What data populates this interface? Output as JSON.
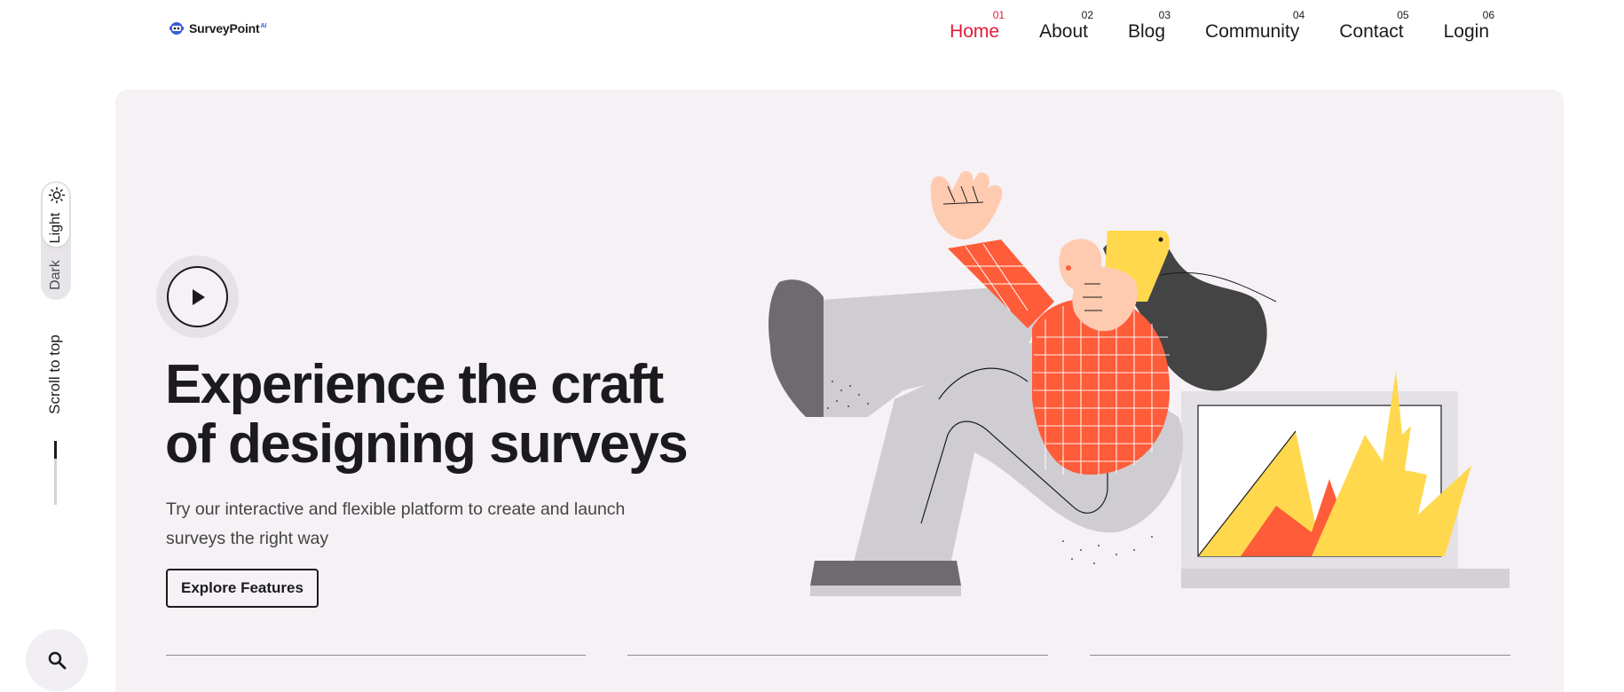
{
  "header": {
    "logo_text": "SurveyPoint",
    "logo_sup": "AI",
    "nav": [
      {
        "num": "01",
        "label": "Home",
        "active": true
      },
      {
        "num": "02",
        "label": "About"
      },
      {
        "num": "03",
        "label": "Blog"
      },
      {
        "num": "04",
        "label": "Community"
      },
      {
        "num": "05",
        "label": "Contact"
      },
      {
        "num": "06",
        "label": "Login"
      }
    ]
  },
  "rail": {
    "theme_light": "Light",
    "theme_dark": "Dark",
    "scroll_to_top": "Scroll to top"
  },
  "hero": {
    "headline_line1": "Experience the craft",
    "headline_line2": "of designing surveys",
    "subtext": "Try our interactive and flexible platform to create and launch surveys the right way",
    "cta_label": "Explore Features"
  },
  "icons": {
    "theme": "sun-icon",
    "play": "play-icon",
    "search": "search-icon",
    "logo": "robot-logo-icon"
  },
  "colors": {
    "accent": "#e41b3a",
    "hero_bg": "#f5f1f5",
    "shirt": "#ff5c3a",
    "phone": "#ffd84d",
    "pants": "#cfcdd2"
  }
}
